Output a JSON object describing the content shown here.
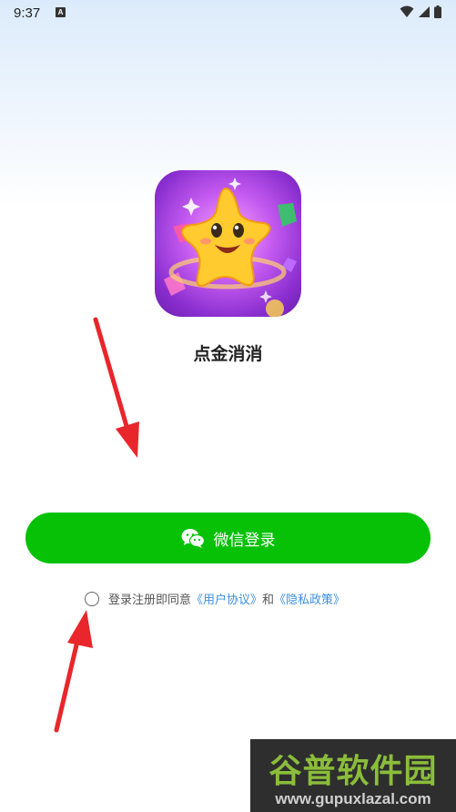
{
  "status_bar": {
    "time": "9:37",
    "notification_badge": "A"
  },
  "app": {
    "name": "点金消消"
  },
  "login": {
    "wechat_button_label": "微信登录"
  },
  "agreement": {
    "checked": false,
    "prefix": "登录注册即同意",
    "user_agreement_link": "《用户协议》",
    "conjunction": "和",
    "privacy_policy_link": "《隐私政策》"
  },
  "watermark": {
    "title": "谷普软件园",
    "url": "www.gupuxlazal.com"
  },
  "colors": {
    "wechat_green": "#07c107",
    "link_blue": "#3e8fe0",
    "annotation_arrow_red": "#e8262b"
  }
}
